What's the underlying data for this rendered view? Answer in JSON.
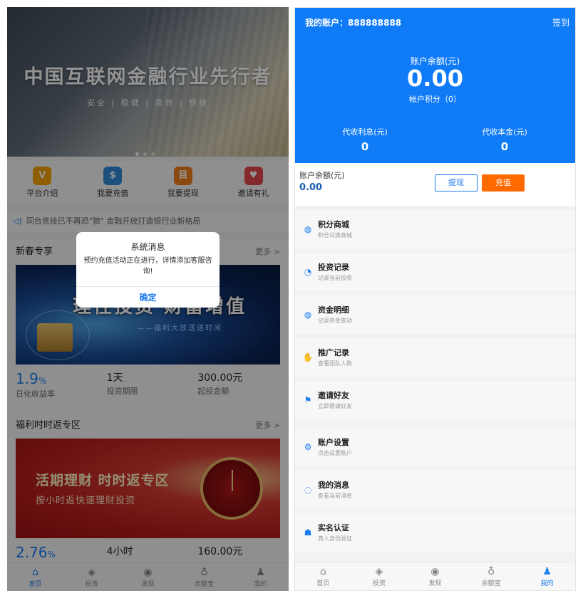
{
  "left": {
    "banner": {
      "title": "中国互联网金融行业先行者",
      "subtitle": "安全 | 稳健 | 高效 | 快捷"
    },
    "quick_links": [
      {
        "label": "平台介绍",
        "icon": "v-badge-icon",
        "glyph": "V",
        "color": "#f5a300"
      },
      {
        "label": "我要充值",
        "icon": "money-bag-icon",
        "glyph": "$",
        "color": "#2f8ad8"
      },
      {
        "label": "我要提现",
        "icon": "withdraw-icon",
        "glyph": "目",
        "color": "#f07e1d"
      },
      {
        "label": "邀请有礼",
        "icon": "gift-icon",
        "glyph": "♥",
        "color": "#e5474c"
      }
    ],
    "notice": "同台竞技已不再恐\"狼\" 金融开放打造银行业新格局",
    "section1": {
      "title": "新春专享",
      "more": "更多 >",
      "banner_title": "理性投资 财富增值",
      "banner_sub": "——福利大放送送时间",
      "stats": [
        {
          "value": "1.9",
          "unit": "%",
          "label": "日化收益率"
        },
        {
          "value": "1天",
          "label": "投资期限"
        },
        {
          "value": "300.00元",
          "label": "起投金额"
        }
      ]
    },
    "section2": {
      "title": "福利时时返专区",
      "more": "更多 >",
      "banner_title": "活期理财 时时返专区",
      "banner_sub": "按小时返快速理财投资",
      "stats": [
        {
          "value": "2.76",
          "unit": "%",
          "label": ""
        },
        {
          "value": "4小时",
          "label": ""
        },
        {
          "value": "160.00元",
          "label": ""
        }
      ]
    },
    "dialog": {
      "title": "系统消息",
      "message": "预约充值活动正在进行，详情添加客服咨询!",
      "ok": "确定"
    },
    "tabs": [
      {
        "label": "首页",
        "glyph": "⌂",
        "active": true
      },
      {
        "label": "投资",
        "glyph": "◈",
        "active": false
      },
      {
        "label": "发现",
        "glyph": "◉",
        "active": false
      },
      {
        "label": "余额宝",
        "glyph": "♁",
        "active": false
      },
      {
        "label": "我的",
        "glyph": "♟",
        "active": false
      }
    ]
  },
  "right": {
    "account_label": "我的账户：888888888",
    "signin": "签到",
    "balance_label": "账户余额(元)",
    "balance_value": "0.00",
    "points": "帐户积分（0）",
    "pending_interest_label": "代收利息(元)",
    "pending_interest_value": "0",
    "pending_principal_label": "代收本金(元)",
    "pending_principal_value": "0",
    "balbar": {
      "label": "账户余额(元)",
      "value": "0.00",
      "withdraw": "提现",
      "recharge": "充值"
    },
    "menu": [
      {
        "title": "积分商城",
        "sub": "积分兑换商城",
        "icon": "chart-circle-icon",
        "glyph": "◍"
      },
      {
        "title": "投资记录",
        "sub": "记录当前投资",
        "icon": "clock-icon",
        "glyph": "◔"
      },
      {
        "title": "资金明细",
        "sub": "记录资金变动",
        "icon": "bar-circle-icon",
        "glyph": "◍"
      },
      {
        "title": "推广记录",
        "sub": "查看团队人数",
        "icon": "handshake-icon",
        "glyph": "✋"
      },
      {
        "title": "邀请好友",
        "sub": "立即邀请好友",
        "icon": "flag-icon",
        "glyph": "⚑"
      },
      {
        "title": "账户设置",
        "sub": "点击设置账户",
        "icon": "settings-icon",
        "glyph": "⚙"
      },
      {
        "title": "我的消息",
        "sub": "查看当前消息",
        "icon": "message-icon",
        "glyph": "◌"
      },
      {
        "title": "实名认证",
        "sub": "真人身份验证",
        "icon": "id-card-icon",
        "glyph": "☗"
      }
    ],
    "tabs": [
      {
        "label": "首页",
        "glyph": "⌂",
        "active": false
      },
      {
        "label": "投资",
        "glyph": "◈",
        "active": false
      },
      {
        "label": "发现",
        "glyph": "◉",
        "active": false
      },
      {
        "label": "余额宝",
        "glyph": "♁",
        "active": false
      },
      {
        "label": "我的",
        "glyph": "♟",
        "active": true
      }
    ]
  }
}
